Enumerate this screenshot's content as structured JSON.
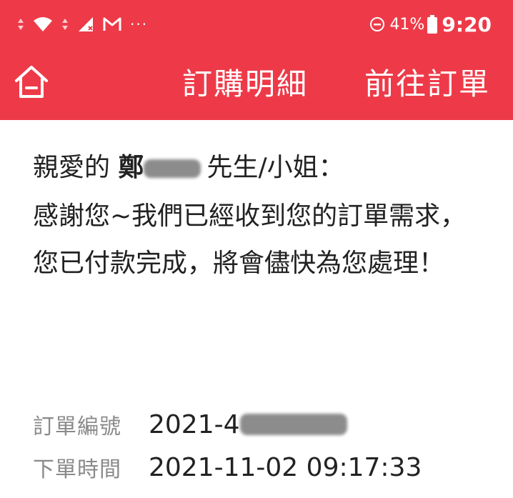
{
  "status_bar": {
    "left_text": "···",
    "battery_percent": "41%",
    "time": "9:20",
    "icons": [
      "signal-arrows-icon",
      "wifi-icon",
      "network-arrows-icon",
      "cell-signal-icon",
      "gmail-icon",
      "more-notifications-icon",
      "do-not-disturb-icon",
      "battery-icon"
    ]
  },
  "header": {
    "title": "訂購明細",
    "action_label": "前往訂單",
    "background_color": "#ee3a48",
    "home_icon": "home-icon"
  },
  "content": {
    "greeting_prefix": "親愛的",
    "name_visible": "鄭",
    "greeting_suffix": "先生/小姐：",
    "message": "感謝您~我們已經收到您的訂單需求，您已付款完成，將會儘快為您處理！"
  },
  "order": {
    "number_label": "訂單編號",
    "number_value_visible": "2021-4",
    "time_label": "下單時間",
    "time_value": "2021-11-02 09:17:33"
  }
}
